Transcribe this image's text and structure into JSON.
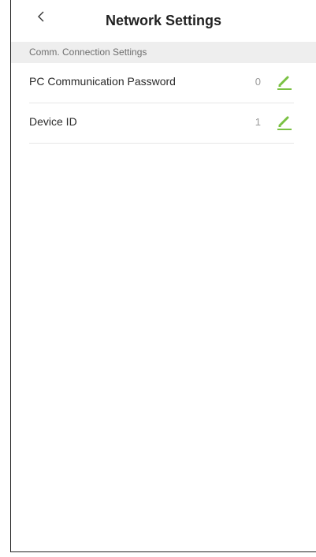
{
  "header": {
    "title": "Network Settings",
    "back_icon": "chevron-left-icon"
  },
  "section": {
    "label": "Comm. Connection Settings"
  },
  "rows": [
    {
      "label": "PC Communication Password",
      "value": "0",
      "icon": "pencil-icon"
    },
    {
      "label": "Device ID",
      "value": "1",
      "icon": "pencil-icon"
    }
  ],
  "colors": {
    "accent": "#7ac143",
    "section_bg": "#eeeeee"
  }
}
